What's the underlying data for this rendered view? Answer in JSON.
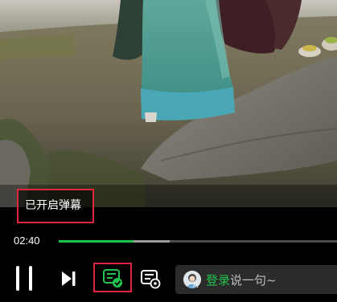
{
  "toast": {
    "text": "已开启弹幕"
  },
  "progress": {
    "current_time": "02:40",
    "played_fraction": 0.27,
    "buffered_fraction": 0.4
  },
  "controls": {
    "pause_icon": "pause-icon",
    "next_icon": "next-episode-icon",
    "danmaku_toggle_icon": "danmaku-on-icon",
    "danmaku_settings_icon": "danmaku-settings-icon"
  },
  "comment": {
    "login_label": "登录",
    "placeholder": "说一句~"
  },
  "colors": {
    "accent_green": "#22c34c",
    "highlight_red": "#e0263f",
    "background": "#000000"
  }
}
